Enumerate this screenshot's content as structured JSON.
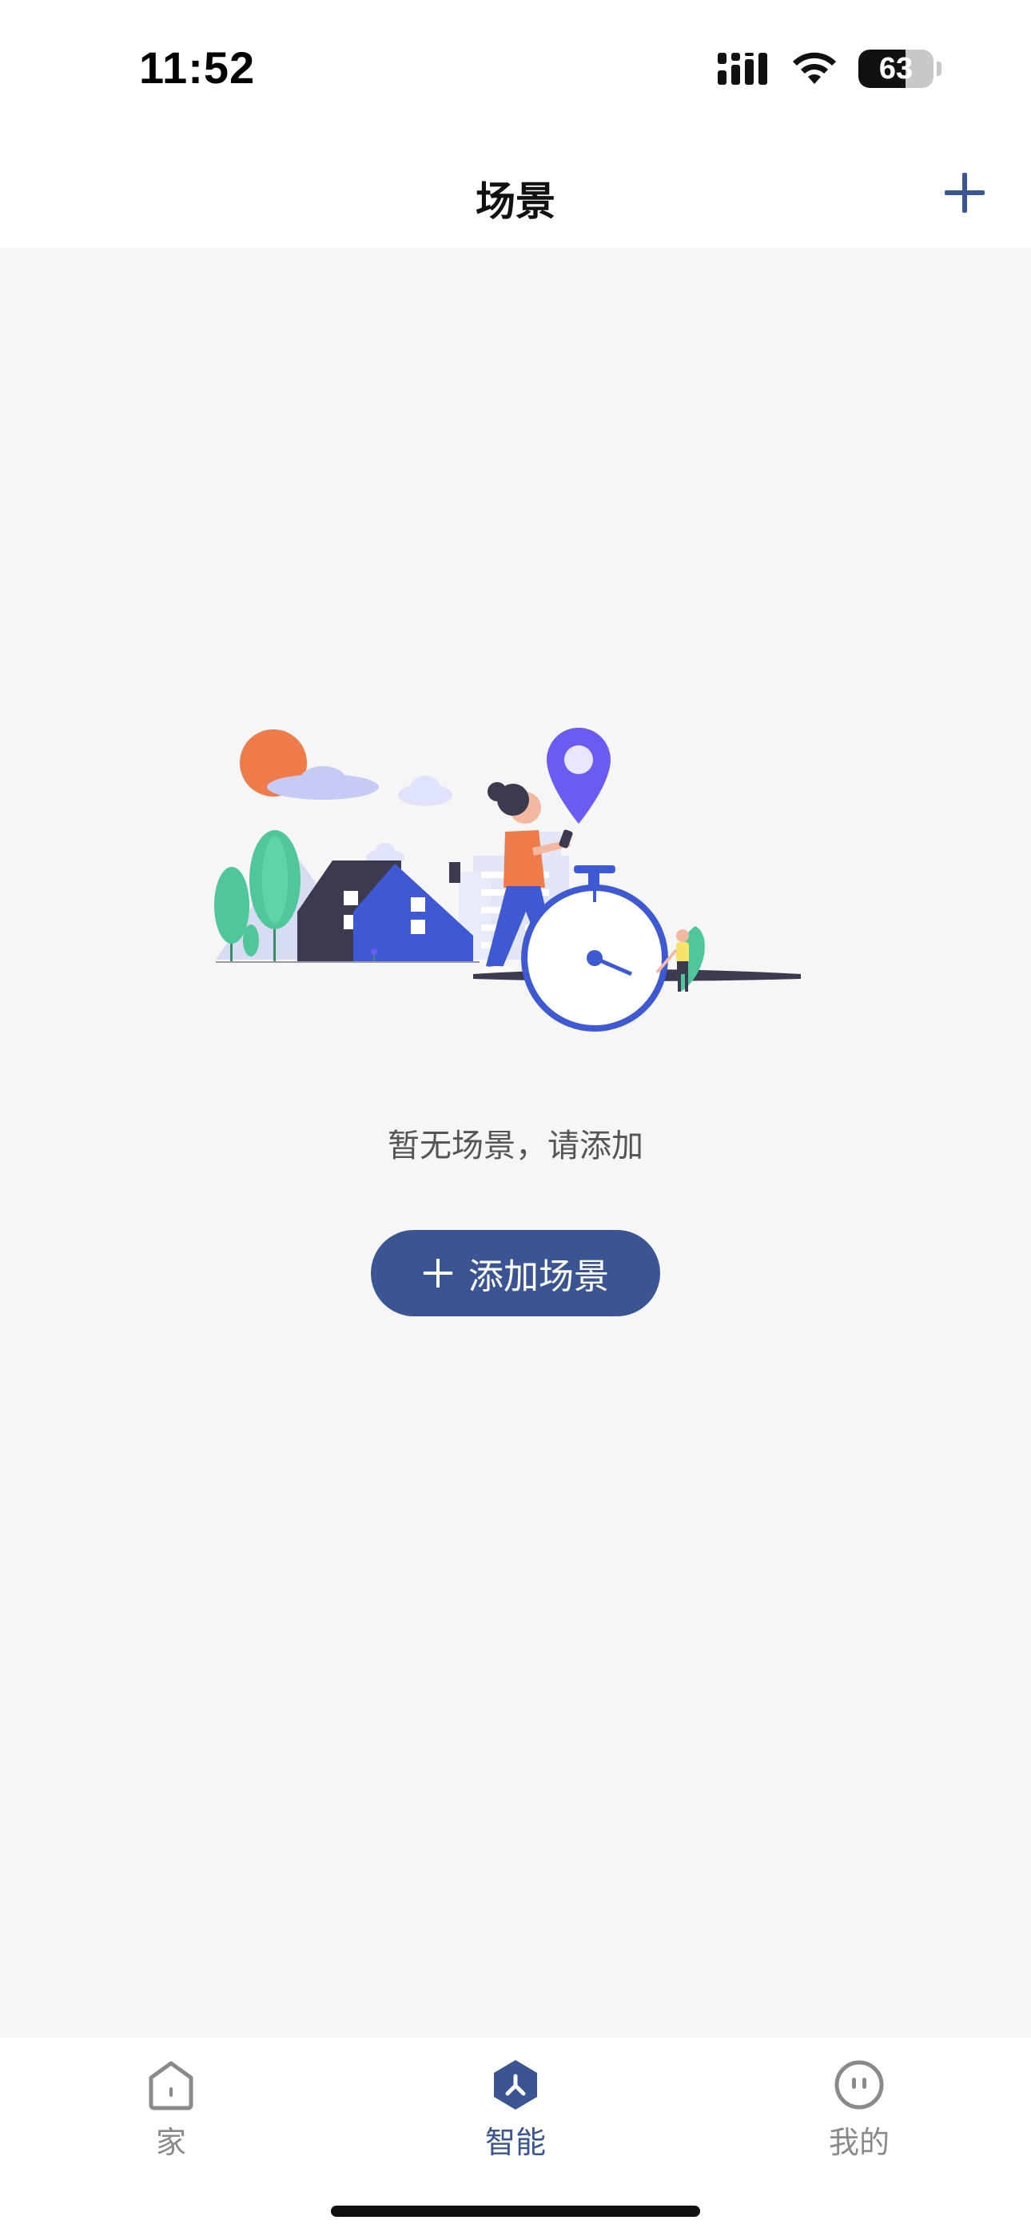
{
  "status_bar": {
    "time": "11:52",
    "battery_percent": "63",
    "battery_level": 0.63,
    "icons": [
      "signal-icon",
      "wifi-icon",
      "battery-icon"
    ]
  },
  "nav": {
    "title": "场景",
    "add_icon": "plus-icon"
  },
  "empty_state": {
    "illustration": "city-person-stopwatch-illustration",
    "message": "暂无场景，请添加",
    "button_label": "添加场景",
    "button_icon": "plus-icon"
  },
  "tab_bar": {
    "tabs": [
      {
        "label": "家",
        "icon": "home-icon",
        "active": false
      },
      {
        "label": "智能",
        "icon": "smart-icon",
        "active": true
      },
      {
        "label": "我的",
        "icon": "profile-icon",
        "active": false
      }
    ]
  },
  "colors": {
    "accent": "#3a5494",
    "background": "#f6f6f6",
    "inactive_tab": "#8a8a8a"
  }
}
